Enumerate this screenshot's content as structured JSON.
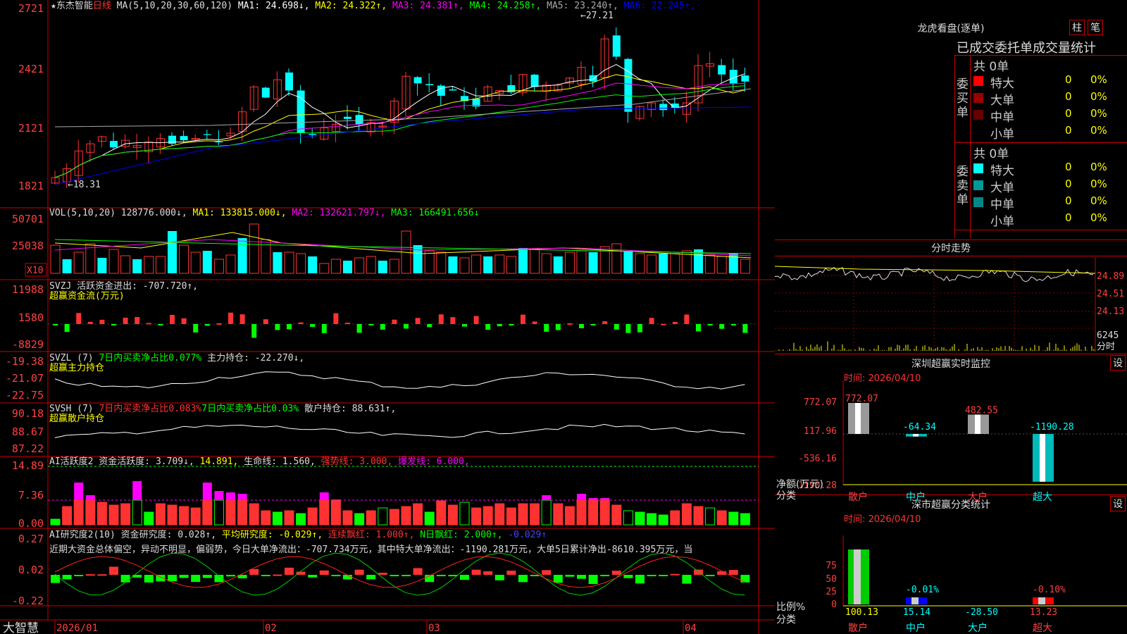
{
  "stock": {
    "name": "东杰智能",
    "period": "日线"
  },
  "main": {
    "ma_label": "MA(5,10,20,30,60,120)",
    "mas": [
      {
        "name": "MA1",
        "value": "24.698",
        "arrow": "↓",
        "color": "#ffffff"
      },
      {
        "name": "MA2",
        "value": "24.322",
        "arrow": "↑",
        "color": "#ffff00"
      },
      {
        "name": "MA3",
        "value": "24.381",
        "arrow": "↑",
        "color": "#ff00ff"
      },
      {
        "name": "MA4",
        "value": "24.258",
        "arrow": "↑",
        "color": "#00ff00"
      },
      {
        "name": "MA5",
        "value": "23.240",
        "arrow": "↑",
        "color": "#aaaaaa"
      },
      {
        "name": "MA6",
        "value": "22.245",
        "arrow": "↑",
        "color": "#0000ff"
      }
    ],
    "ylabels": [
      "2721",
      "2421",
      "2121",
      "1821"
    ],
    "high_label": "27.21",
    "low_label": "18.31"
  },
  "vol": {
    "label": "VOL(5,10,20)",
    "value": "128776.000",
    "arrow": "↓",
    "ma1": "MA1: 133815.000↓",
    "ma2": "MA2: 132621.797↓",
    "ma3": "MA3: 166491.656↓",
    "ylabels": [
      "50701",
      "25038"
    ],
    "unit": "X10"
  },
  "svzj": {
    "label": "SVZJ  活跃资金进出: -707.720↑,",
    "sub": "超赢资金流(万元)",
    "ylabels": [
      "11988",
      "1580",
      "-8829"
    ]
  },
  "svzl": {
    "label": "SVZL (7)",
    "green": "7日内买卖净占比0.077%",
    "rest": " 主力持仓: -22.270↓,",
    "sub": "超赢主力持仓",
    "ylabels": [
      "-19.38",
      "-21.07",
      "-22.75"
    ]
  },
  "svsh": {
    "label": "SVSH (7)",
    "red": "7日内买卖净占比0.083%",
    "green": "7日内买卖净占比0.03%",
    "rest": " 散户持仓: 88.631↑,",
    "sub": "超赢散户持仓",
    "ylabels": [
      "90.18",
      "88.67",
      "87.22"
    ]
  },
  "ai1": {
    "label": "AI活跃度2 资金活跃度: 3.709↓,",
    "v2": "14.891,",
    "v3": "生命线: 1.560,",
    "v4": "强势线: 3.000,",
    "v5": "爆发线: 6.000,",
    "ylabels": [
      "14.89",
      "7.36",
      "0.00"
    ]
  },
  "ai2": {
    "label": "AI研究度2(10) 资金研究度: 0.028↑,",
    "v2": "平均研究度: -0.029↑,",
    "v3": "连续飘红: 1.000↑,",
    "v4": "N日飘红: 2.000↑,",
    "v5": "-0.029↑",
    "text": "近期大资金总体偏空，异动不明显，偏弱势，今日大单净流出：-707.734万元，其中特大单净流出：-1190.281万元，大单5日累计净出-8610.395万元，当",
    "ylabels": [
      "0.27",
      "0.02",
      "-0.22"
    ]
  },
  "xaxis": {
    "logo": "大智慧",
    "labels": [
      "2026/01",
      "02",
      "03",
      "04"
    ]
  },
  "dragon": {
    "title": "龙虎看盘(逐单)",
    "btn1": "柱",
    "btn2": "笔",
    "tabs": "已成交委托单成交量统计",
    "buy": {
      "side": "委买单",
      "total": "共 0单",
      "rows": [
        [
          "特大",
          "0",
          "0%"
        ],
        [
          "大单",
          "0",
          "0%"
        ],
        [
          "中单",
          "0",
          "0%"
        ],
        [
          "小单",
          "0",
          "0%"
        ]
      ]
    },
    "sell": {
      "side": "委卖单",
      "total": "共 0单",
      "rows": [
        [
          "特大",
          "0",
          "0%"
        ],
        [
          "大单",
          "0",
          "0%"
        ],
        [
          "中单",
          "0",
          "0%"
        ],
        [
          "小单",
          "0",
          "0%"
        ]
      ]
    }
  },
  "intraday": {
    "title": "分时走势",
    "ylabels": [
      "24.89",
      "24.51",
      "24.13"
    ],
    "vol": "6245",
    "sub": "分时"
  },
  "monitor": {
    "title": "深圳超赢实时监控",
    "btn": "设",
    "time": "时间: 2026/04/10",
    "ylabels": [
      "772.07",
      "117.96",
      "-536.16",
      "-1190.28"
    ],
    "bars": [
      {
        "cat": "散户",
        "value": "772.07"
      },
      {
        "cat": "中户",
        "value": "-64.34"
      },
      {
        "cat": "大户",
        "value": "482.55"
      },
      {
        "cat": "超大",
        "value": "-1190.28"
      }
    ],
    "unit": "净额(万元)",
    "cat": "分类"
  },
  "classify": {
    "title": "深市超赢分类统计",
    "btn": "设",
    "time": "时间: 2026/04/10",
    "ylabels": [
      "75",
      "50",
      "25",
      "0"
    ],
    "bars": [
      {
        "cat": "散户",
        "top": "",
        "bottom": "100.13"
      },
      {
        "cat": "中户",
        "top": "-0.01%",
        "bottom": "15.14"
      },
      {
        "cat": "大户",
        "top": "",
        "bottom": "-28.50"
      },
      {
        "cat": "超大",
        "top": "-0.10%",
        "bottom": "13.23"
      }
    ],
    "unit": "比例%",
    "cat": "分类"
  }
}
